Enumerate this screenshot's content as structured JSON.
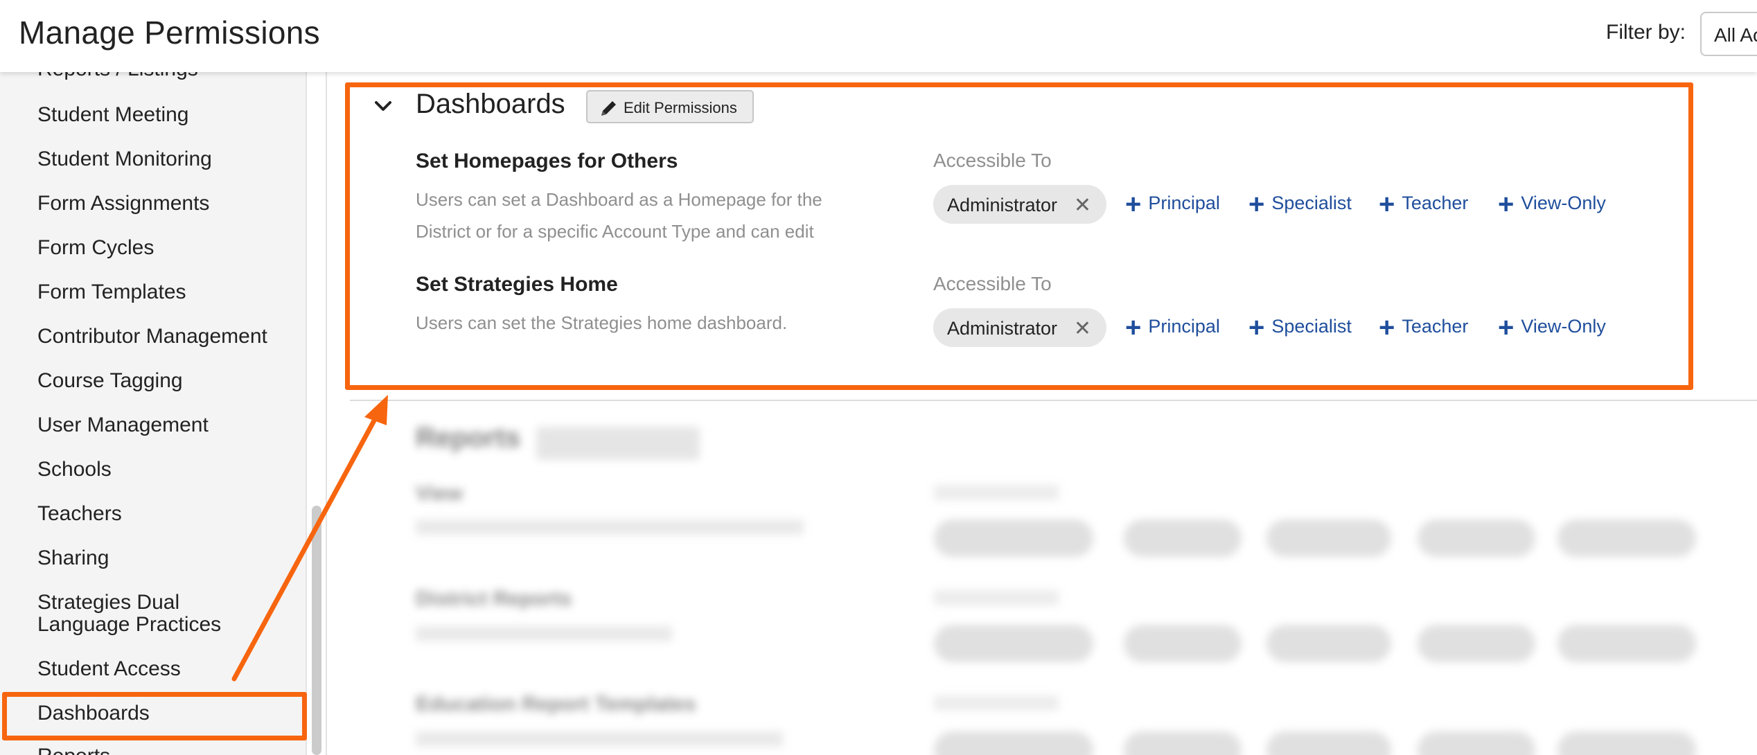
{
  "header": {
    "title": "Manage Permissions",
    "filter_label": "Filter by:",
    "filter_value": "All Ac"
  },
  "sidebar": {
    "items": [
      {
        "label": "Reports / Listings"
      },
      {
        "label": "Student Meeting"
      },
      {
        "label": "Student Monitoring"
      },
      {
        "label": "Form Assignments"
      },
      {
        "label": "Form Cycles"
      },
      {
        "label": "Form Templates"
      },
      {
        "label": "Contributor Management"
      },
      {
        "label": "Course Tagging"
      },
      {
        "label": "User Management"
      },
      {
        "label": "Schools"
      },
      {
        "label": "Teachers"
      },
      {
        "label": "Sharing"
      },
      {
        "label": "Strategies Dual",
        "label2": "Language Practices"
      },
      {
        "label": "Student Access"
      },
      {
        "label": "Dashboards"
      },
      {
        "label": "Reports"
      }
    ]
  },
  "section": {
    "title": "Dashboards",
    "edit_button": "Edit Permissions",
    "permissions": [
      {
        "title": "Set Homepages for Others",
        "desc_line1": "Users can set a Dashboard as a Homepage for the",
        "desc_line2": "District or for a specific Account Type and can edit",
        "accessible_label": "Accessible To",
        "assigned": "Administrator",
        "add_roles": [
          "Principal",
          "Specialist",
          "Teacher",
          "View-Only"
        ]
      },
      {
        "title": "Set Strategies Home",
        "desc_line1": "Users can set the Strategies home dashboard.",
        "accessible_label": "Accessible To",
        "assigned": "Administrator",
        "add_roles": [
          "Principal",
          "Specialist",
          "Teacher",
          "View-Only"
        ]
      }
    ]
  },
  "blurred_section": {
    "title": "Reports",
    "rows": [
      {
        "title": "View"
      },
      {
        "title": "District Reports"
      },
      {
        "title": "Education Report Templates"
      }
    ]
  },
  "colors": {
    "annotation": "#f7650f",
    "link": "#1f4e9c"
  }
}
